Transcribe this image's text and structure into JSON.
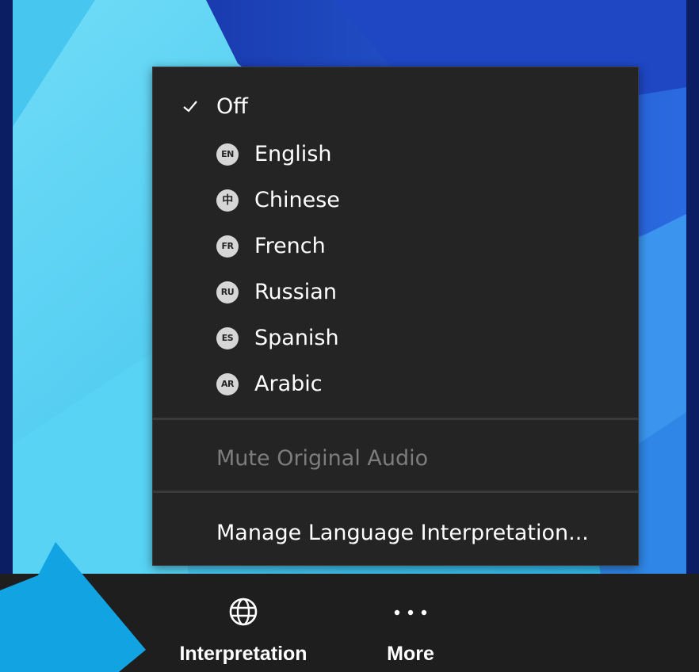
{
  "menu": {
    "off": {
      "label": "Off",
      "checked": true,
      "icon": "checkmark-icon"
    },
    "languages": [
      {
        "code": "EN",
        "label": "English"
      },
      {
        "code": "中",
        "label": "Chinese"
      },
      {
        "code": "FR",
        "label": "French"
      },
      {
        "code": "RU",
        "label": "Russian"
      },
      {
        "code": "ES",
        "label": "Spanish"
      },
      {
        "code": "AR",
        "label": "Arabic"
      }
    ],
    "mute_original_audio": {
      "label": "Mute Original Audio",
      "enabled": false
    },
    "manage": {
      "label": "Manage Language Interpretation..."
    }
  },
  "toolbar": {
    "interpretation": {
      "label": "Interpretation",
      "icon": "globe-icon"
    },
    "more": {
      "label": "More",
      "icon": "ellipsis-icon"
    }
  },
  "colors": {
    "menu_bg": "#242424",
    "toolbar_bg": "#1e1e1e",
    "disabled_text": "#7d7d7d",
    "callout": "#12a3e3",
    "wallpaper_light": "#3ec8f5",
    "wallpaper_dark": "#1d3fb8"
  }
}
